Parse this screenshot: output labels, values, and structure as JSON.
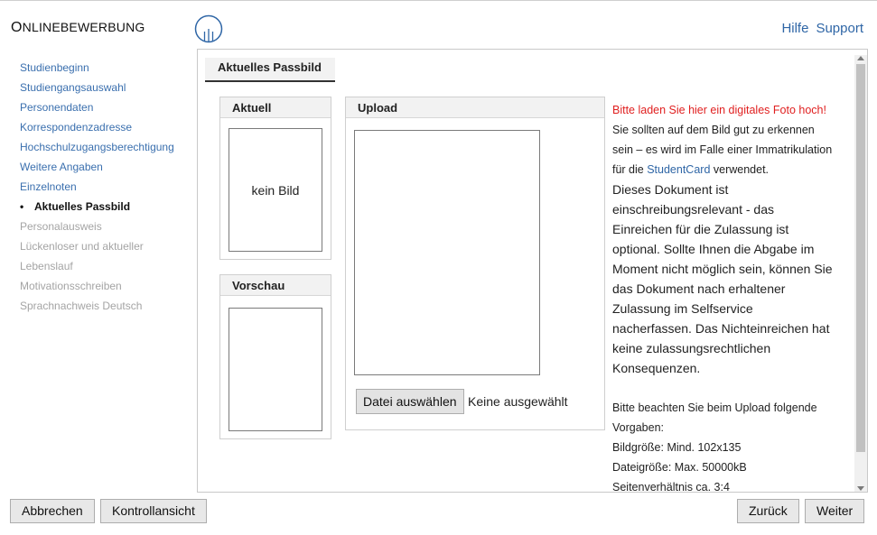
{
  "brand": {
    "first": "O",
    "rest": "NLINEBEWERBUNG"
  },
  "toplinks": {
    "help": "Hilfe",
    "support": "Support"
  },
  "sidebar": {
    "items": [
      {
        "label": "Studienbeginn"
      },
      {
        "label": "Studiengangsauswahl"
      },
      {
        "label": "Personendaten"
      },
      {
        "label": "Korrespondenzadresse"
      },
      {
        "label": "Hochschulzugangsberechtigung"
      },
      {
        "label": "Weitere Angaben"
      },
      {
        "label": "Einzelnoten"
      },
      {
        "label": "Aktuelles Passbild",
        "bullet": "•"
      },
      {
        "label": "Personalausweis"
      },
      {
        "label": "Lückenloser und aktueller"
      },
      {
        "label": "Lebenslauf"
      },
      {
        "label": "Motivationsschreiben"
      },
      {
        "label": "Sprachnachweis Deutsch"
      }
    ]
  },
  "main": {
    "tab": "Aktuelles Passbild",
    "aktuell": {
      "header": "Aktuell",
      "empty": "kein Bild"
    },
    "vorschau": {
      "header": "Vorschau"
    },
    "upload": {
      "header": "Upload",
      "button": "Datei auswählen",
      "status": "Keine ausgewählt"
    },
    "info": {
      "l1": "Bitte laden Sie hier ein digitales Foto hoch!",
      "l2": "Sie sollten auf dem Bild gut zu erkennen",
      "l3": "sein – es wird im Falle einer Immatrikulation",
      "l4a": "für die ",
      "l4b": "StudentCard",
      "l4c": " verwendet.",
      "p1": "Dieses Dokument ist",
      "p2": "einschreibungsrelevant - das",
      "p3": "Einreichen für die Zulassung ist",
      "p4": "optional. Sollte Ihnen die Abgabe im",
      "p5": "Moment nicht möglich sein, können Sie",
      "p6": "das Dokument nach erhaltener",
      "p7": "Zulassung im Selfservice",
      "p8": "nacherfassen. Das Nichteinreichen hat",
      "p9": "keine zulassungsrechtlichen",
      "p10": "Konsequenzen.",
      "v1": "Bitte beachten Sie beim Upload folgende",
      "v2": "Vorgaben:",
      "v3": "Bildgröße: Mind. 102x135",
      "v4": "Dateigröße: Max. 50000kB",
      "v5": "Seitenverhältnis ca. 3:4"
    }
  },
  "footer": {
    "cancel": "Abbrechen",
    "control": "Kontrollansicht",
    "back": "Zurück",
    "next": "Weiter"
  },
  "colors": {
    "link": "#2f66a6",
    "accent_red": "#e02020",
    "disabled": "#a4a4a4"
  }
}
